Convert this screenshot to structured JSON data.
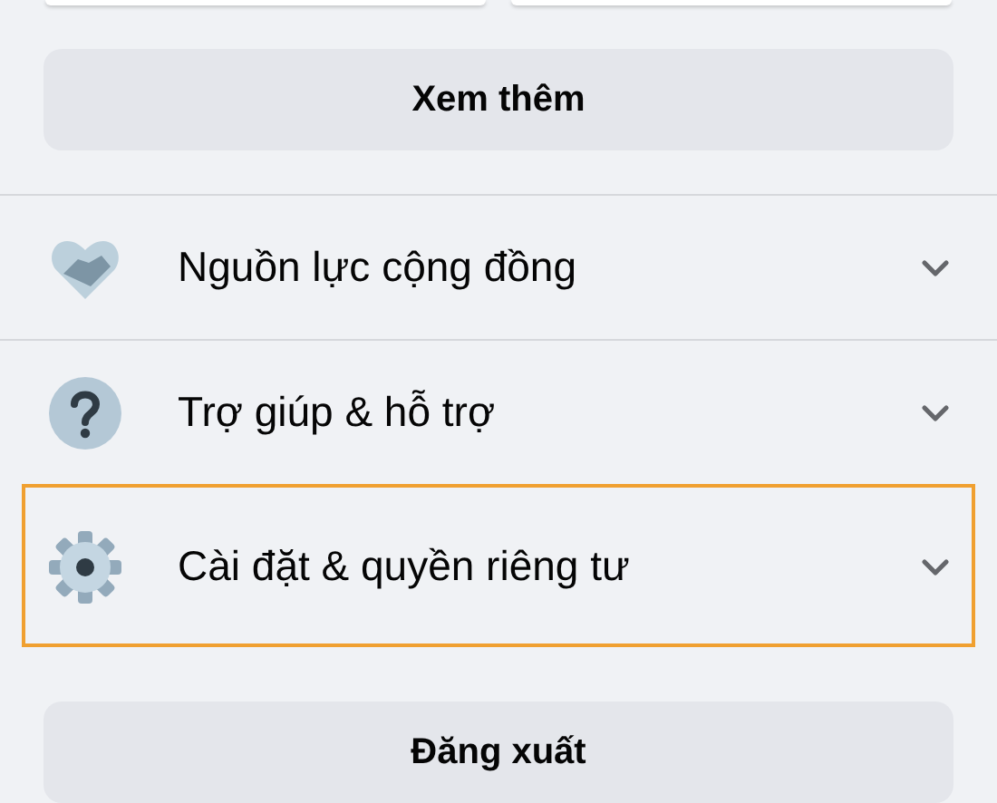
{
  "top_cards": [
    {
      "kind": "card"
    },
    {
      "kind": "card"
    }
  ],
  "see_more": {
    "label": "Xem thêm"
  },
  "sections": [
    {
      "label": "Nguồn lực cộng đồng",
      "kind": "handshake",
      "expanded": false,
      "selected": false
    },
    {
      "label": "Trợ giúp & hỗ trợ",
      "kind": "help",
      "expanded": false,
      "selected": false
    },
    {
      "label": "Cài đặt & quyền riêng tư",
      "kind": "settings",
      "expanded": false,
      "selected": true
    }
  ],
  "logout": {
    "label": "Đăng xuất"
  }
}
